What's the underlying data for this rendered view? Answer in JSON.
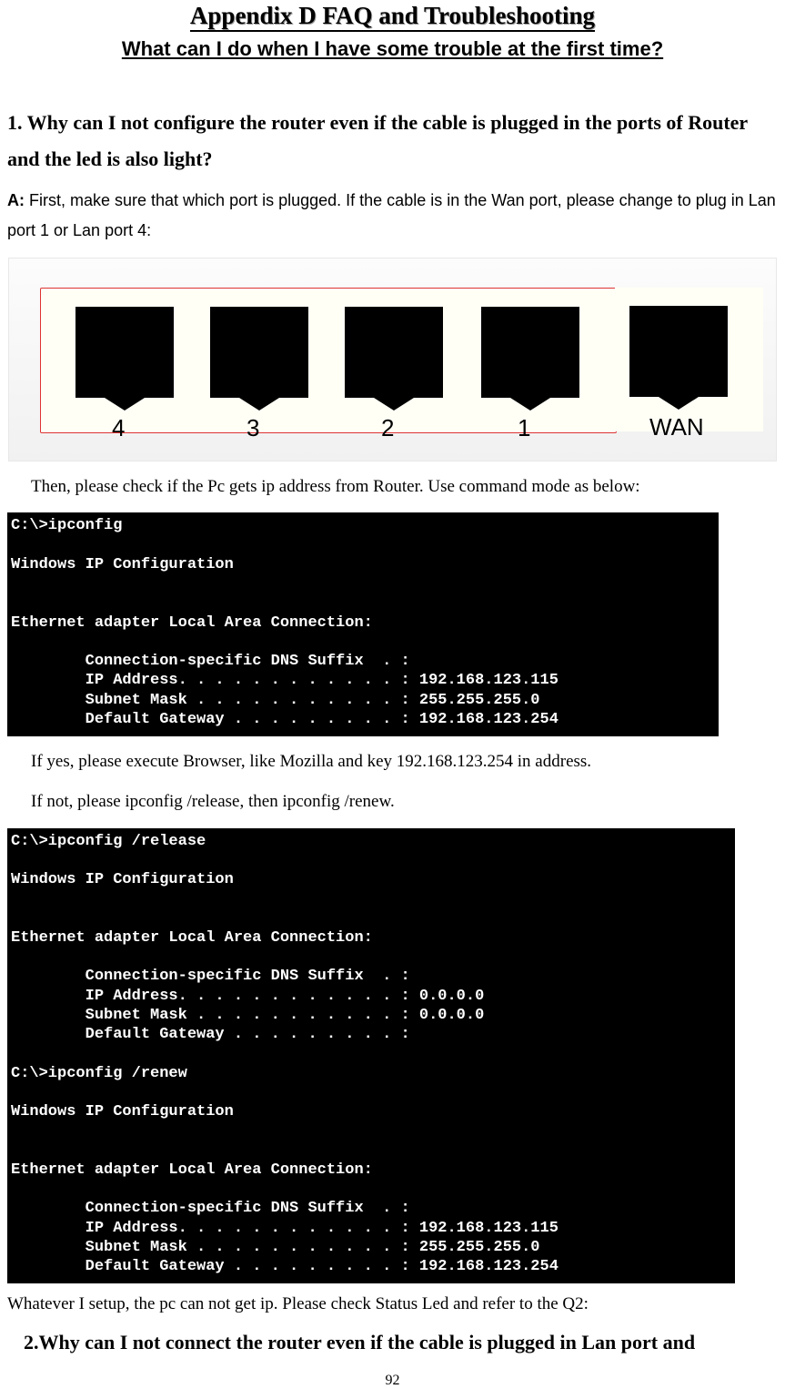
{
  "title": "Appendix D    FAQ and Troubleshooting",
  "subtitle": "What can I do when I have some trouble at the first time?",
  "q1": "1. Why can I not configure the router even if the cable is plugged in the ports of Router and the led is also light?",
  "a1_prefix": "A: ",
  "a1_body": "First, make sure that which port is plugged. If the cable is in the Wan port, please change to plug in Lan port 1 or Lan port 4:",
  "ports": {
    "p4": "4",
    "p3": "3",
    "p2": "2",
    "p1": "1",
    "wan": "WAN"
  },
  "then_text": "Then, please check if the Pc gets ip address from Router. Use command mode as below:",
  "cmd1": "C:\\>ipconfig\n\nWindows IP Configuration\n\n\nEthernet adapter Local Area Connection:\n\n        Connection-specific DNS Suffix  . :\n        IP Address. . . . . . . . . . . . : 192.168.123.115\n        Subnet Mask . . . . . . . . . . . : 255.255.255.0\n        Default Gateway . . . . . . . . . : 192.168.123.254",
  "if_yes": "If yes, please execute Browser, like Mozilla and key 192.168.123.254 in address.",
  "if_not": "If not, please ipconfig /release, then ipconfig /renew.",
  "cmd2": "C:\\>ipconfig /release\n\nWindows IP Configuration\n\n\nEthernet adapter Local Area Connection:\n\n        Connection-specific DNS Suffix  . :\n        IP Address. . . . . . . . . . . . : 0.0.0.0\n        Subnet Mask . . . . . . . . . . . : 0.0.0.0\n        Default Gateway . . . . . . . . . :\n\nC:\\>ipconfig /renew\n\nWindows IP Configuration\n\n\nEthernet adapter Local Area Connection:\n\n        Connection-specific DNS Suffix  . :\n        IP Address. . . . . . . . . . . . : 192.168.123.115\n        Subnet Mask . . . . . . . . . . . : 255.255.255.0\n        Default Gateway . . . . . . . . . : 192.168.123.254",
  "whatever": "Whatever I setup, the pc can not get ip. Please check Status Led and refer to the Q2:",
  "q2": "2.Why can I not connect the router even if the cable is plugged in Lan port and",
  "page_num": "92"
}
